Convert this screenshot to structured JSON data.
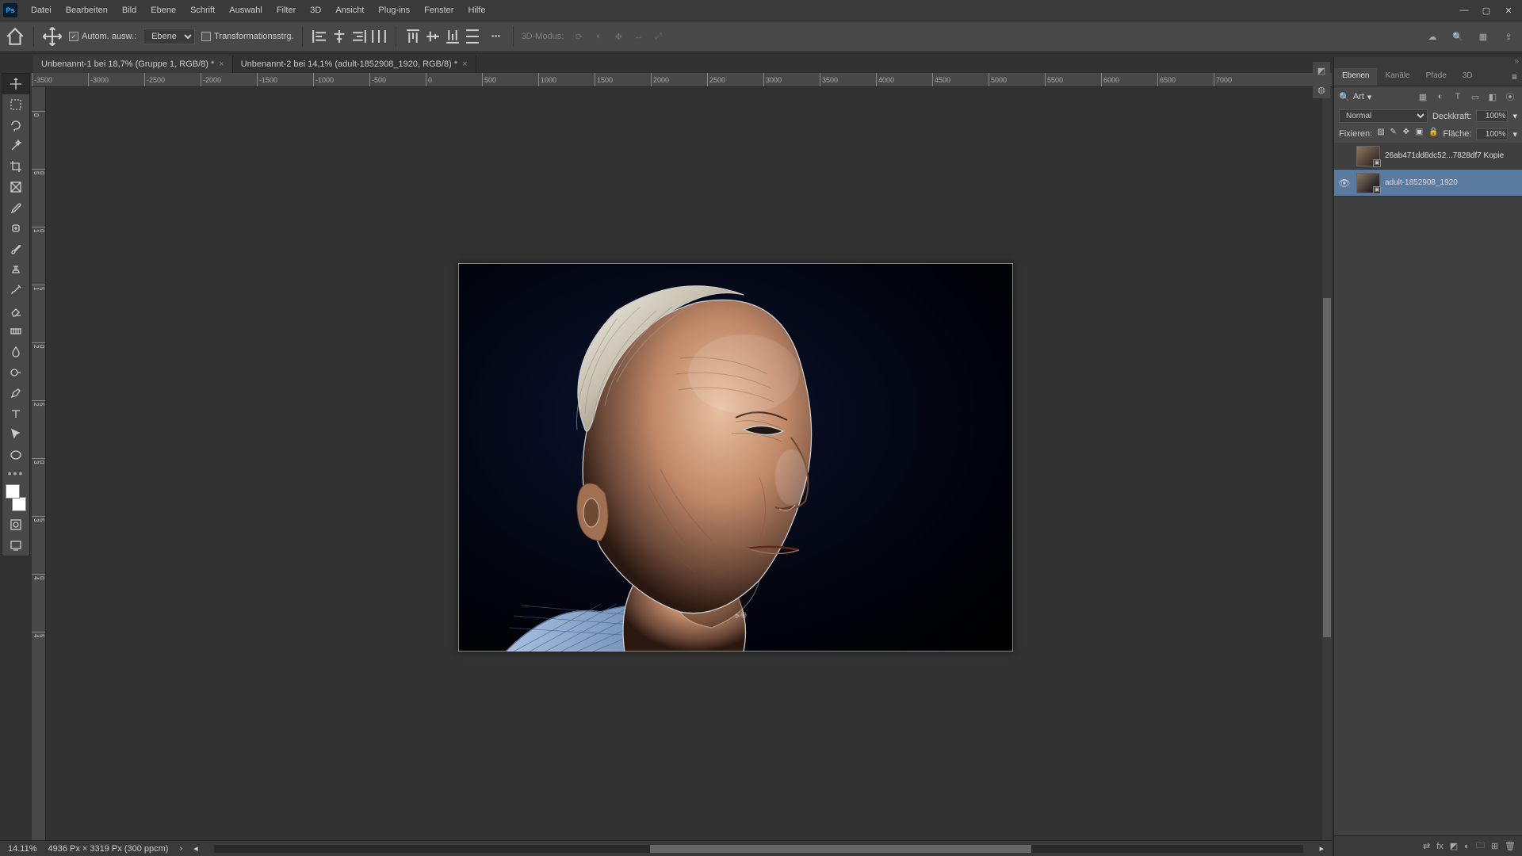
{
  "menubar": [
    "Datei",
    "Bearbeiten",
    "Bild",
    "Ebene",
    "Schrift",
    "Auswahl",
    "Filter",
    "3D",
    "Ansicht",
    "Plug-ins",
    "Fenster",
    "Hilfe"
  ],
  "optbar": {
    "auto_select": "Autom. ausw.:",
    "target": "Ebene",
    "transform": "Transformationsstrg.",
    "mode3d": "3D-Modus:"
  },
  "tabs": [
    {
      "label": "Unbenannt-1 bei 18,7% (Gruppe 1, RGB/8) *"
    },
    {
      "label": "Unbenannt-2 bei 14,1% (adult-1852908_1920, RGB/8) *"
    }
  ],
  "hruler": [
    "-3500",
    "-3000",
    "-2500",
    "-2000",
    "-1500",
    "-1000",
    "-500",
    "0",
    "500",
    "1000",
    "1500",
    "2000",
    "2500",
    "3000",
    "3500",
    "4000",
    "4500",
    "5000",
    "5500",
    "6000",
    "6500",
    "7000"
  ],
  "vruler": [
    "0",
    "500",
    "1000",
    "1500",
    "2000",
    "2500",
    "3000",
    "3500",
    "4000",
    "4500"
  ],
  "panel": {
    "tabs": [
      "Ebenen",
      "Kanäle",
      "Pfade",
      "3D"
    ],
    "search": "Art",
    "blend": "Normal",
    "opacity_label": "Deckkraft:",
    "opacity": "100%",
    "lock_label": "Fixieren:",
    "fill_label": "Fläche:",
    "fill": "100%"
  },
  "layers": [
    {
      "visible": false,
      "name": "26ab471dd8dc52...7828df7 Kopie"
    },
    {
      "visible": true,
      "name": "adult-1852908_1920"
    }
  ],
  "status": {
    "zoom": "14.11%",
    "dims": "4936 Px × 3319 Px (300 ppcm)"
  }
}
